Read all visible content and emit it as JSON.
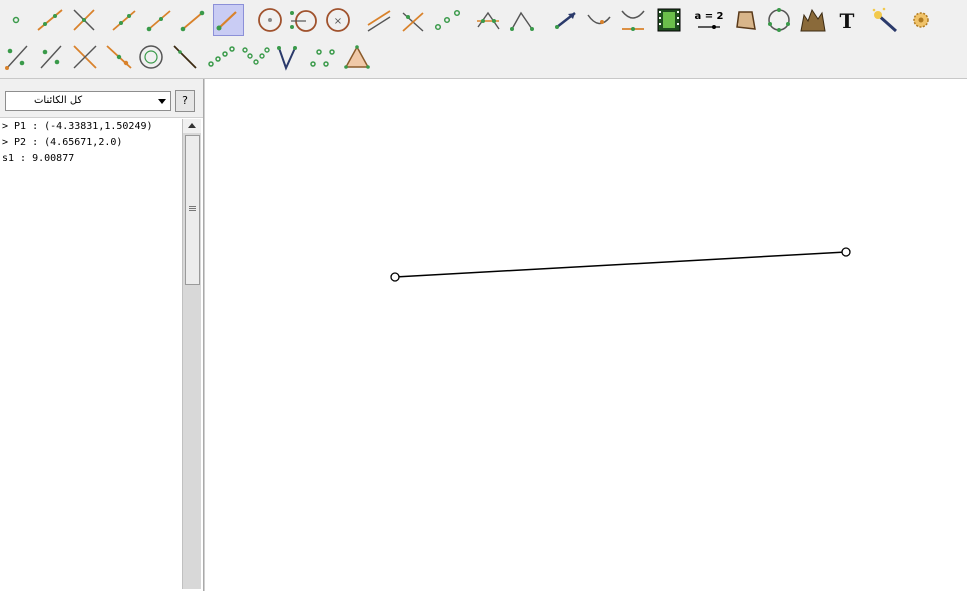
{
  "toolbar": {
    "tools": [
      {
        "name": "point-tool-icon"
      },
      {
        "name": "line-through-two-points-icon"
      },
      {
        "name": "perpendicular-line-icon"
      },
      {
        "name": "segment-tool-icon"
      },
      {
        "name": "ray-tool-icon"
      },
      {
        "name": "vector-tool-icon"
      },
      {
        "name": "segment-given-length-icon",
        "selected": true
      },
      {
        "name": "circle-center-point-icon"
      },
      {
        "name": "circle-compass-icon"
      },
      {
        "name": "circle-center-radius-icon"
      },
      {
        "name": "parallel-line-icon"
      },
      {
        "name": "angle-bisector-icon"
      },
      {
        "name": "midpoint-icon"
      },
      {
        "name": "intersect-icon"
      },
      {
        "name": "angle-tool-icon"
      },
      {
        "name": "move-graphics-icon"
      },
      {
        "name": "conic-tool-icon"
      },
      {
        "name": "function-inspector-icon"
      },
      {
        "name": "animation-film-icon"
      },
      {
        "name": "slider-tool-icon",
        "label": "a = 2"
      },
      {
        "name": "polygon-tool-icon"
      },
      {
        "name": "circle-through-points-icon"
      },
      {
        "name": "locus-tool-icon"
      },
      {
        "name": "text-tool-icon",
        "label": "T"
      },
      {
        "name": "magic-wand-icon"
      },
      {
        "name": "gear-icon"
      },
      {
        "name": "reflect-point-icon"
      },
      {
        "name": "reflect-line-icon"
      },
      {
        "name": "cross-lines-icon"
      },
      {
        "name": "tangent-line-icon"
      },
      {
        "name": "circle-tool-icon"
      },
      {
        "name": "polar-line-icon"
      },
      {
        "name": "fit-line-icon"
      },
      {
        "name": "locus-points-icon"
      },
      {
        "name": "dilate-icon"
      },
      {
        "name": "relation-tool-icon"
      },
      {
        "name": "triangle-tool-icon"
      }
    ]
  },
  "panel": {
    "filter": "كل الكائنات",
    "help": "?"
  },
  "algebra": {
    "rows": [
      "> P1 : (-4.33831,1.50249)",
      "> P2 : (4.65671,2.0)",
      "s1 : 9.00877"
    ]
  },
  "colors": {
    "toolbar_bg": "#f0f0f0",
    "selected_tool": "#c9ccf4",
    "line_orange": "#d9822b",
    "point_green": "#3a9a4a",
    "segment": "#000000"
  }
}
